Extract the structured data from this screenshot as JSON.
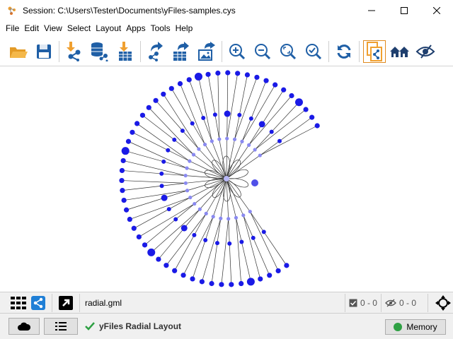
{
  "window": {
    "title": "Session: C:\\Users\\Tester\\Documents\\yFiles-samples.cys"
  },
  "menu": [
    "File",
    "Edit",
    "View",
    "Select",
    "Layout",
    "Apps",
    "Tools",
    "Help"
  ],
  "toolbar": {
    "icons": [
      "open-session-icon",
      "save-session-icon",
      "import-network-icon",
      "import-network-database-icon",
      "import-table-icon",
      "export-network-icon",
      "export-table-icon",
      "export-image-icon",
      "zoom-in-icon",
      "zoom-out-icon",
      "zoom-fit-icon",
      "zoom-selected-icon",
      "refresh-icon",
      "network-from-selection-icon",
      "home-icon",
      "show-hide-icon"
    ]
  },
  "panel": {
    "file_name": "radial.gml",
    "selected_counter": "0 - 0",
    "hidden_counter": "0 - 0"
  },
  "status": {
    "message": "yFiles Radial Layout",
    "memory_label": "Memory",
    "memory_color": "#2ea043"
  },
  "colors": {
    "node": "#1a1ae6",
    "node_light": "#8a8af0",
    "edge": "#333333",
    "accent_orange": "#f0a030",
    "accent_blue": "#1f5fa6"
  }
}
